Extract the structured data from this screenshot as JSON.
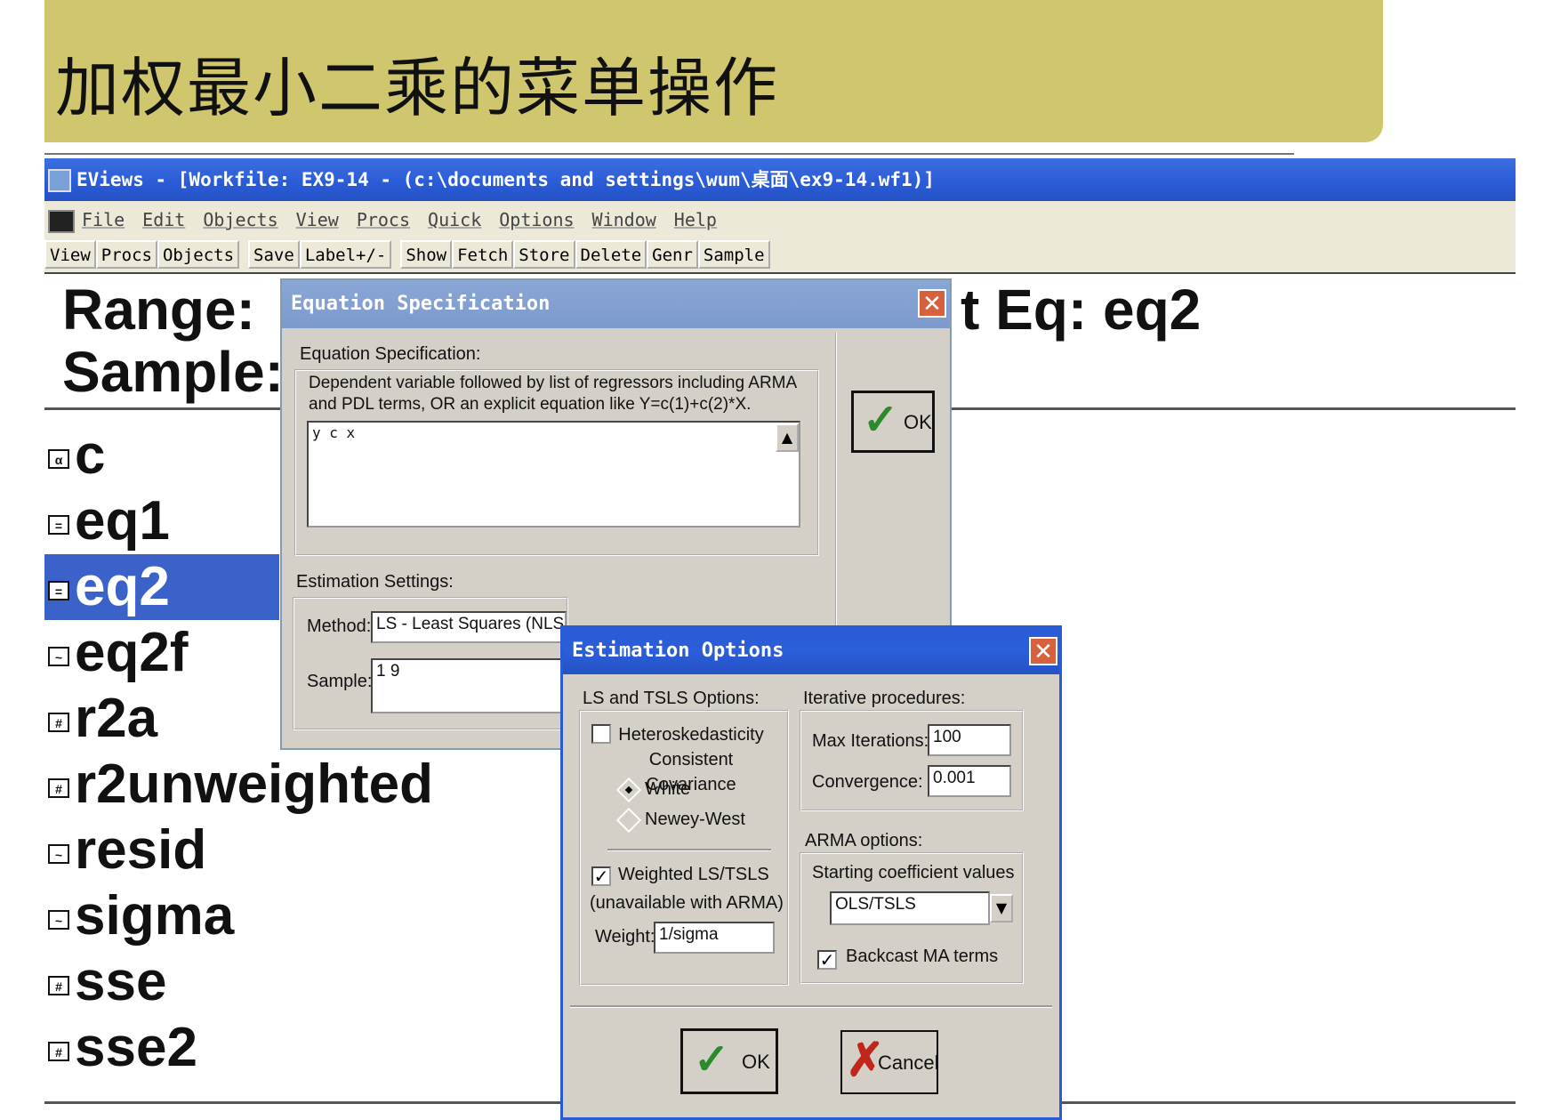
{
  "slide": {
    "title": "加权最小二乘的菜单操作"
  },
  "window": {
    "title": "EViews - [Workfile: EX9-14 - (c:\\documents and settings\\wum\\桌面\\ex9-14.wf1)]"
  },
  "menu": [
    "File",
    "Edit",
    "Objects",
    "View",
    "Procs",
    "Quick",
    "Options",
    "Window",
    "Help"
  ],
  "toolbar": {
    "group1": [
      "View",
      "Procs",
      "Objects"
    ],
    "group2": [
      "Save",
      "Label+/-"
    ],
    "group3": [
      "Show",
      "Fetch",
      "Store",
      "Delete",
      "Genr",
      "Sample"
    ]
  },
  "workfile": {
    "range_label": "Range:",
    "sample_label": "Sample:",
    "filter_fragment": "t Eq: eq2",
    "items": [
      {
        "name": "c",
        "icon": "alpha-icon"
      },
      {
        "name": "eq1",
        "icon": "equation-icon"
      },
      {
        "name": "eq2",
        "icon": "equation-icon",
        "selected": true
      },
      {
        "name": "eq2f",
        "icon": "series-icon"
      },
      {
        "name": "r2a",
        "icon": "scalar-icon"
      },
      {
        "name": "r2unweighted",
        "icon": "scalar-icon"
      },
      {
        "name": "resid",
        "icon": "series-icon"
      },
      {
        "name": "sigma",
        "icon": "series-icon"
      },
      {
        "name": "sse",
        "icon": "scalar-icon"
      },
      {
        "name": "sse2",
        "icon": "scalar-icon"
      }
    ]
  },
  "eq_dialog": {
    "title": "Equation Specification",
    "group_label": "Equation Specification:",
    "description": "Dependent variable followed by list of regressors including ARMA and PDL terms, OR an explicit equation like Y=c(1)+c(2)*X.",
    "equation": "y c x",
    "settings_label": "Estimation Settings:",
    "method_label": "Method:",
    "method_value": "LS  -  Least Squares (NLS",
    "sample_label": "Sample:",
    "sample_value": "1 9",
    "ok_label": "OK"
  },
  "est_dialog": {
    "title": "Estimation Options",
    "ls_group": "LS and TSLS Options:",
    "hetero_label": "Heteroskedasticity Consistent Covariance",
    "white_label": "White",
    "newey_label": "Newey-West",
    "weighted_label": "Weighted LS/TSLS",
    "weighted_note": "(unavailable with ARMA)",
    "weight_label": "Weight:",
    "weight_value": "1/sigma",
    "iter_group": "Iterative procedures:",
    "max_iter_label": "Max Iterations:",
    "max_iter_value": "100",
    "convergence_label": "Convergence:",
    "convergence_value": "0.001",
    "arma_group": "ARMA options:",
    "start_coef_label": "Starting coefficient values",
    "start_coef_value": "OLS/TSLS",
    "backcast_label": "Backcast MA terms",
    "ok_label": "OK",
    "cancel_label": "Cancel"
  },
  "colors": {
    "banner": "#cfc66e",
    "titlebar": "#2a5bd7",
    "selection": "#3b62c9",
    "dialog": "#d4d0c8"
  }
}
